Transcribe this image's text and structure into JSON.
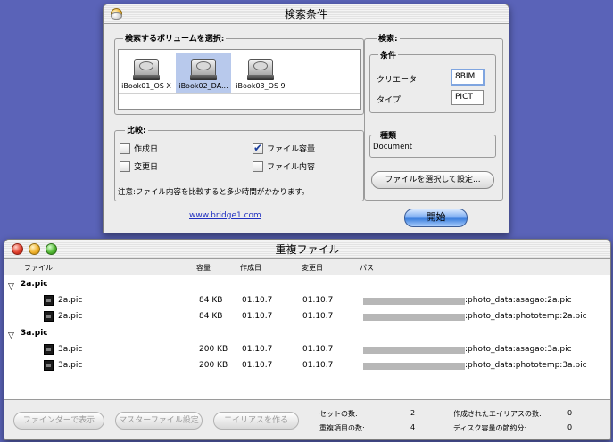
{
  "search_window": {
    "title": "検索条件",
    "volume_group_label": "検索するボリュームを選択:",
    "volumes": [
      {
        "label": "iBook01_OS X"
      },
      {
        "label": "iBook02_DA..."
      },
      {
        "label": "iBook03_OS 9"
      }
    ],
    "compare_group_label": "比較:",
    "compare_options": {
      "created": {
        "label": "作成日",
        "checked": false
      },
      "modified": {
        "label": "変更日",
        "checked": false
      },
      "size": {
        "label": "ファイル容量",
        "checked": true
      },
      "content": {
        "label": "ファイル内容",
        "checked": false
      }
    },
    "note": "注意:ファイル内容を比較すると多少時間がかかります。",
    "link": "www.bridge1.com",
    "search_group_label": "検索:",
    "conditions_label": "条件",
    "creator_label": "クリエータ:",
    "creator_value": "8BIM",
    "type_label": "タイプ:",
    "type_value": "PICT",
    "kind_label": "種類",
    "kind_value": "Document",
    "choose_file_button": "ファイルを選択して設定...",
    "start_button": "開始"
  },
  "dup_window": {
    "title": "重複ファイル",
    "columns": {
      "file": "ファイル",
      "size": "容量",
      "created": "作成日",
      "modified": "変更日",
      "path": "パス"
    },
    "groups": [
      {
        "name": "2a.pic",
        "files": [
          {
            "name": "2a.pic",
            "size": "84 KB",
            "created": "01.10.7",
            "modified": "01.10.7",
            "path": ":photo_data:asagao:2a.pic"
          },
          {
            "name": "2a.pic",
            "size": "84 KB",
            "created": "01.10.7",
            "modified": "01.10.7",
            "path": ":photo_data:phototemp:2a.pic"
          }
        ]
      },
      {
        "name": "3a.pic",
        "files": [
          {
            "name": "3a.pic",
            "size": "200 KB",
            "created": "01.10.7",
            "modified": "01.10.7",
            "path": ":photo_data:asagao:3a.pic"
          },
          {
            "name": "3a.pic",
            "size": "200 KB",
            "created": "01.10.7",
            "modified": "01.10.7",
            "path": ":photo_data:phototemp:3a.pic"
          }
        ]
      }
    ],
    "buttons": {
      "finder": "ファインダーで表示",
      "master": "マスターファイル設定",
      "alias": "エイリアスを作る"
    },
    "stats": {
      "sets_label": "セットの数:",
      "sets_value": "2",
      "dups_label": "重複項目の数:",
      "dups_value": "4",
      "aliases_label": "作成されたエイリアスの数:",
      "aliases_value": "0",
      "saved_label": "ディスク容量の節約分:",
      "saved_value": "0"
    }
  }
}
